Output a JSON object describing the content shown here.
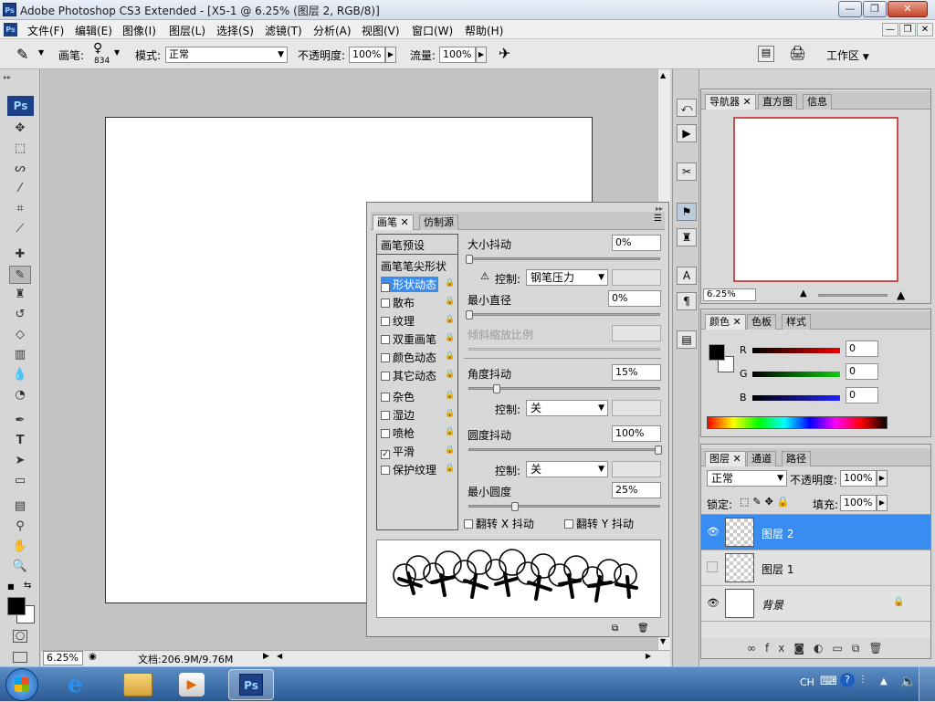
{
  "window": {
    "title": "Adobe Photoshop CS3 Extended - [X5-1 @ 6.25% (图层 2, RGB/8)]",
    "app_icon": "Ps"
  },
  "menu": [
    "文件(F)",
    "编辑(E)",
    "图像(I)",
    "图层(L)",
    "选择(S)",
    "滤镜(T)",
    "分析(A)",
    "视图(V)",
    "窗口(W)",
    "帮助(H)"
  ],
  "options": {
    "brush_label": "画笔:",
    "brush_size": "834",
    "mode_label": "模式:",
    "mode_value": "正常",
    "opacity_label": "不透明度:",
    "opacity_value": "100%",
    "flow_label": "流量:",
    "flow_value": "100%",
    "workspace_label": "工作区"
  },
  "status": {
    "zoom": "6.25%",
    "doc_info": "文档:206.9M/9.76M"
  },
  "brush_panel": {
    "tabs": [
      "画笔",
      "仿制源"
    ],
    "presets": "画笔预设",
    "tip_shape": "画笔笔尖形状",
    "options": [
      {
        "label": "形状动态",
        "checked": true,
        "active": true
      },
      {
        "label": "散布",
        "checked": false
      },
      {
        "label": "纹理",
        "checked": false
      },
      {
        "label": "双重画笔",
        "checked": false
      },
      {
        "label": "颜色动态",
        "checked": false
      },
      {
        "label": "其它动态",
        "checked": false
      },
      {
        "label": "杂色",
        "checked": false
      },
      {
        "label": "湿边",
        "checked": false
      },
      {
        "label": "喷枪",
        "checked": false
      },
      {
        "label": "平滑",
        "checked": true
      },
      {
        "label": "保护纹理",
        "checked": false
      }
    ],
    "size_jitter_label": "大小抖动",
    "size_jitter_value": "0%",
    "control_label": "控制:",
    "size_control": "钢笔压力",
    "min_diameter_label": "最小直径",
    "min_diameter_value": "0%",
    "tilt_scale_label": "倾斜缩放比例",
    "angle_jitter_label": "角度抖动",
    "angle_jitter_value": "15%",
    "angle_control": "关",
    "roundness_jitter_label": "圆度抖动",
    "roundness_jitter_value": "100%",
    "roundness_control": "关",
    "min_roundness_label": "最小圆度",
    "min_roundness_value": "25%",
    "flip_x": "翻转 X 抖动",
    "flip_y": "翻转 Y 抖动"
  },
  "navigator": {
    "tabs": [
      "导航器",
      "直方图",
      "信息"
    ],
    "zoom": "6.25%"
  },
  "color": {
    "tabs": [
      "颜色",
      "色板",
      "样式"
    ],
    "r_label": "R",
    "g_label": "G",
    "b_label": "B",
    "r": "0",
    "g": "0",
    "b": "0",
    "fg": "#000000",
    "bg": "#ffffff"
  },
  "layers": {
    "tabs": [
      "图层",
      "通道",
      "路径"
    ],
    "blend": "正常",
    "opacity_label": "不透明度:",
    "opacity": "100%",
    "lock_label": "锁定:",
    "fill_label": "填充:",
    "fill": "100%",
    "items": [
      {
        "name": "图层 2",
        "visible": true,
        "active": true
      },
      {
        "name": "图层 1",
        "visible": false
      },
      {
        "name": "背景",
        "visible": true,
        "locked": true
      }
    ]
  },
  "tray": {
    "lang": "CH"
  },
  "accent": "#3a8df0"
}
